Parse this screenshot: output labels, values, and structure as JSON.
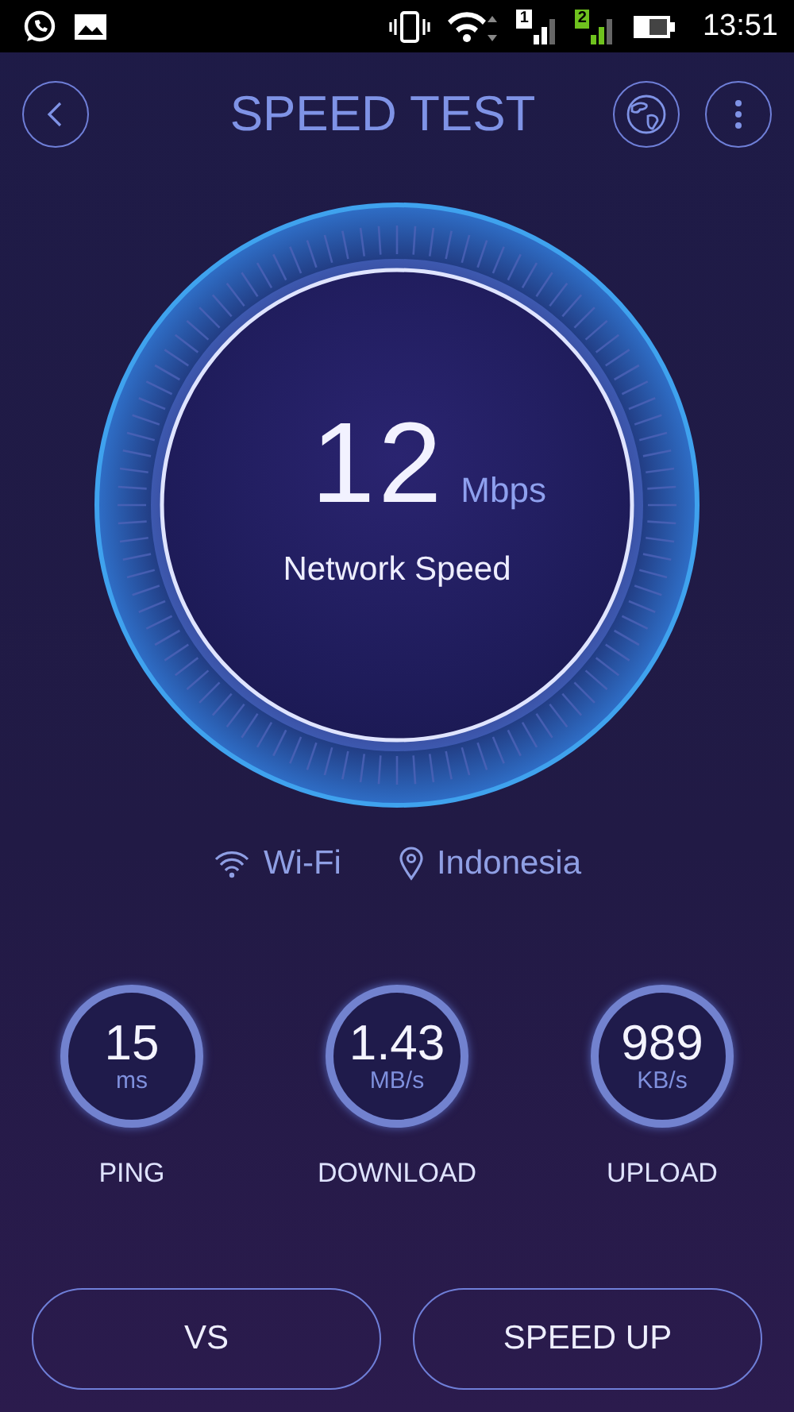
{
  "status_bar": {
    "time": "13:51",
    "sims": [
      {
        "label": "1",
        "color": "#ffffff"
      },
      {
        "label": "2",
        "color": "#6fc21e"
      }
    ]
  },
  "header": {
    "title": "SPEED TEST"
  },
  "gauge": {
    "value": "12",
    "unit": "Mbps",
    "label": "Network Speed"
  },
  "connection": {
    "network": "Wi-Fi",
    "location": "Indonesia"
  },
  "stats": [
    {
      "value": "15",
      "unit": "ms",
      "label": "PING"
    },
    {
      "value": "1.43",
      "unit": "MB/s",
      "label": "DOWNLOAD"
    },
    {
      "value": "989",
      "unit": "KB/s",
      "label": "UPLOAD"
    }
  ],
  "buttons": [
    "VS",
    "SPEED UP"
  ]
}
